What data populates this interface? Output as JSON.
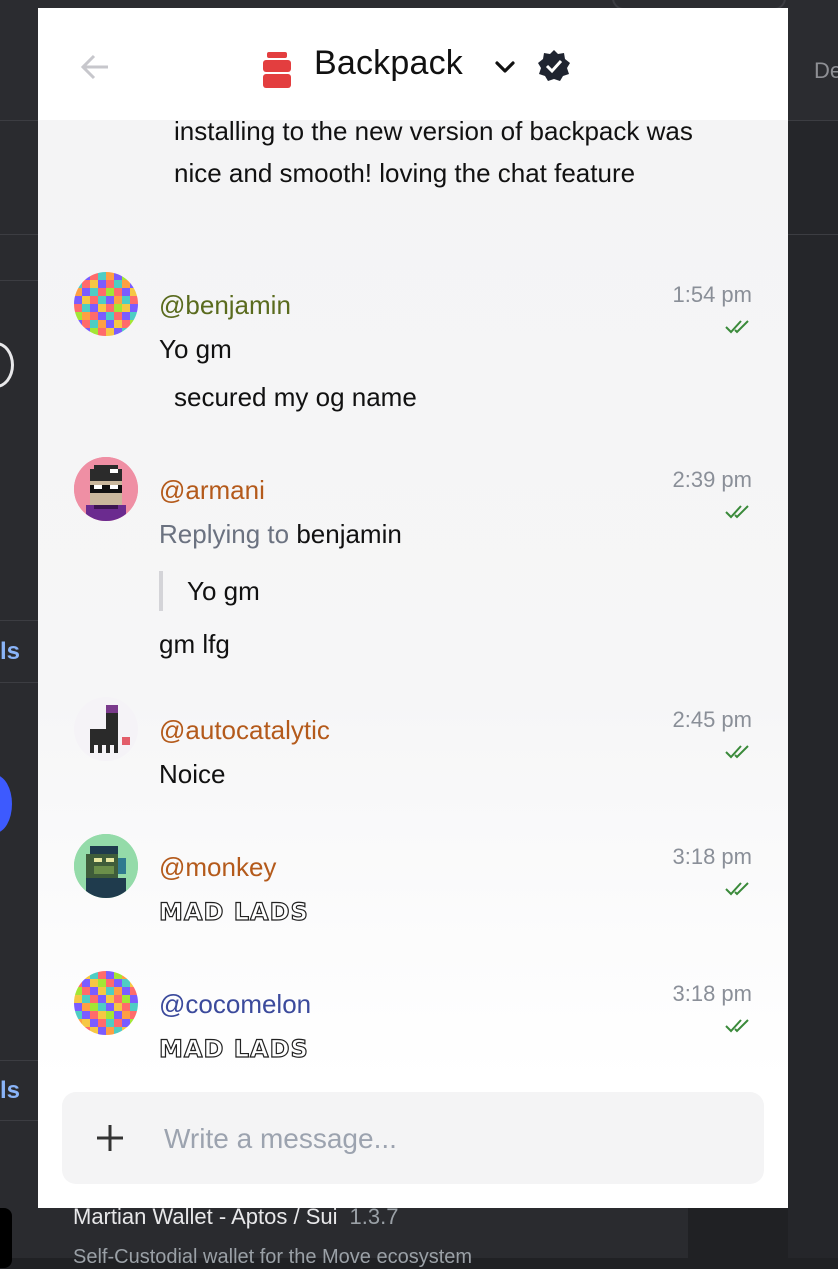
{
  "background": {
    "partial_tab_text": "De",
    "side_text_1": "ls",
    "side_text_2": "ls",
    "extension_name": "Martian Wallet - Aptos / Sui",
    "extension_version": "1.3.7",
    "extension_desc": "Self-Custodial wallet for the Move ecosystem"
  },
  "header": {
    "title": "Backpack",
    "back_icon": "arrow-left-icon",
    "dropdown_icon": "chevron-down-icon",
    "verified_icon": "verified-badge-icon"
  },
  "messages": {
    "top_partial": "installing to the new version of backpack was nice and smooth! loving the chat feature",
    "list": [
      {
        "username": "@benjamin",
        "time": "1:54 pm",
        "lines": [
          "Yo gm",
          "secured my og name"
        ],
        "color": "#5a6b1e"
      },
      {
        "username": "@armani",
        "time": "2:39 pm",
        "reply_prefix": "Replying to",
        "reply_user": "benjamin",
        "quote": "Yo gm",
        "text": "gm lfg",
        "color": "#b45a1b"
      },
      {
        "username": "@autocatalytic",
        "time": "2:45 pm",
        "text": "Noice",
        "color": "#b45a1b"
      },
      {
        "username": "@monkey",
        "time": "3:18 pm",
        "text": "MAD LADS",
        "color": "#b45a1b"
      },
      {
        "username": "@cocomelon",
        "time": "3:18 pm",
        "text": "MAD LADS",
        "color": "#3b4a9c"
      }
    ]
  },
  "composer": {
    "placeholder": "Write a message...",
    "value": "",
    "add_icon": "plus-icon"
  },
  "colors": {
    "read_ticks": "#3a8a3a",
    "brand_red": "#e33e3f"
  }
}
